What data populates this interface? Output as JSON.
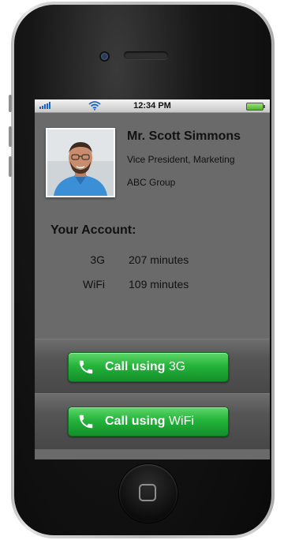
{
  "status_bar": {
    "time": "12:34 PM"
  },
  "contact": {
    "name": "Mr. Scott Simmons",
    "title": "Vice President, Marketing",
    "company": "ABC Group"
  },
  "account": {
    "heading": "Your Account:",
    "rows": [
      {
        "type": "3G",
        "minutes": "207 minutes"
      },
      {
        "type": "WiFi",
        "minutes": "109 minutes"
      }
    ]
  },
  "actions": {
    "call_3g": {
      "prefix": "Call using",
      "network": "3G"
    },
    "call_wifi": {
      "prefix": "Call using",
      "network": "WiFi"
    }
  },
  "colors": {
    "call_button": "#25b43b",
    "screen_bg": "#6a6a6a"
  },
  "icons": [
    "signal-icon",
    "wifi-icon",
    "battery-icon",
    "phone-handset-icon",
    "home-button-icon"
  ]
}
